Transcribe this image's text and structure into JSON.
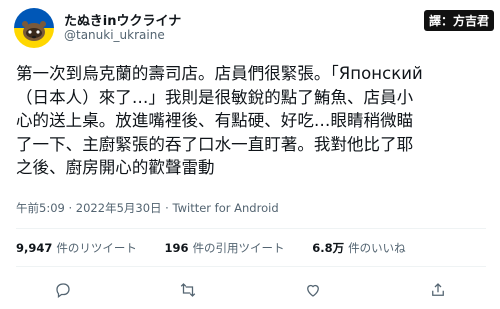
{
  "author": {
    "display_name": "たぬきinウクライナ",
    "handle": "@tanuki_ukraine",
    "avatar_colors": {
      "top": "#0057b7",
      "bottom": "#ffd700"
    }
  },
  "watermark": "譯：方吉君",
  "tweet": {
    "lines": [
      "第一次到烏克蘭的壽司店。店員們很緊張。「Японский",
      "（日本人）來了…」我則是很敏銳的點了鮪魚、店員小",
      "心的送上桌。放進嘴裡後、有點硬、好吃…眼睛稍微瞄",
      "了一下、主廚緊張的吞了口水一直盯著。我對他比了耶",
      "之後、廚房開心的歡聲雷動"
    ]
  },
  "meta": {
    "time": "午前5:09",
    "date": "2022年5月30日",
    "separator": "·",
    "source": "Twitter for Android"
  },
  "stats": {
    "retweets_count": "9,947",
    "retweets_label": "件のリツイート",
    "quotes_count": "196",
    "quotes_label": "件の引用ツイート",
    "likes_count": "6.8万",
    "likes_label": "件のいいね"
  },
  "actions": [
    "reply-icon",
    "retweet-icon",
    "like-icon",
    "share-icon"
  ]
}
